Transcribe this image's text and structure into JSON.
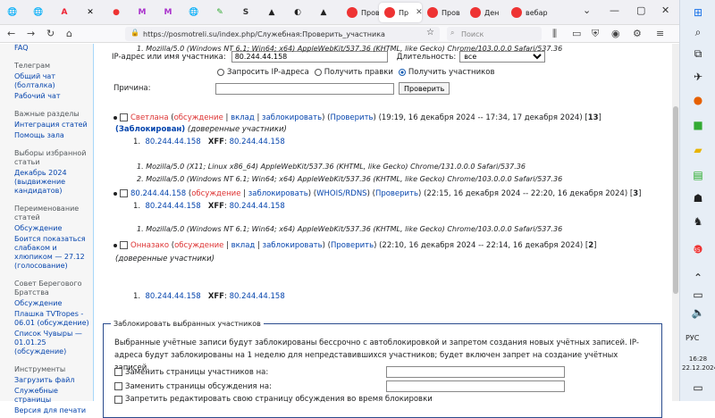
{
  "browser": {
    "pinned": [
      {
        "icon": "globe-icon",
        "char": "🌐",
        "color": "#666"
      },
      {
        "icon": "globe-icon",
        "char": "🌐",
        "color": "#666"
      },
      {
        "icon": "a-letter-icon",
        "char": "A",
        "color": "#e23"
      },
      {
        "icon": "x-icon",
        "char": "✕",
        "color": "#000"
      },
      {
        "icon": "opera-icon",
        "char": "●",
        "color": "#e33"
      },
      {
        "icon": "m-letter-icon",
        "char": "M",
        "color": "#a3c"
      },
      {
        "icon": "m-letter-icon",
        "char": "M",
        "color": "#a3c"
      },
      {
        "icon": "globe-icon",
        "char": "🌐",
        "color": "#666"
      },
      {
        "icon": "lock-icon",
        "char": "✎",
        "color": "#3a3"
      },
      {
        "icon": "s-letter-icon",
        "char": "S",
        "color": "#333"
      },
      {
        "icon": "triangle-icon",
        "char": "▲",
        "color": "#222"
      },
      {
        "icon": "circle-icon",
        "char": "◐",
        "color": "#222"
      },
      {
        "icon": "triangle-icon",
        "char": "▲",
        "color": "#222"
      }
    ],
    "tabs": [
      {
        "label": "Пров",
        "active": false
      },
      {
        "label": "Пр",
        "active": true
      },
      {
        "label": "Пров",
        "active": false
      },
      {
        "label": "Ден",
        "active": false
      },
      {
        "label": "вебар",
        "active": false
      }
    ],
    "url": "https://posmotreli.su/index.php/Служебная:Проверить_участника",
    "search_placeholder": "Поиск"
  },
  "sidebar": {
    "sections": [
      {
        "heading": "",
        "links": [
          "FAQ"
        ]
      },
      {
        "heading": "Телеграм",
        "links": [
          "Общий чат (болталка)",
          "Рабочий чат"
        ]
      },
      {
        "heading": "Важные разделы",
        "links": [
          "Интеграция статей",
          "Помощь зала"
        ]
      },
      {
        "heading": "Выборы избранной статьи",
        "links": [
          "Декабрь 2024 (выдвижение кандидатов)"
        ]
      },
      {
        "heading": "Переименование статей",
        "links": [
          "Обсуждение",
          "Боится показаться слабаком и хлюпиком — 27.12 (голосование)"
        ]
      },
      {
        "heading": "Совет Берегового Братства",
        "links": [
          "Обсуждение",
          "Плашка TVTropes - 06.01 (обсуждение)",
          "Список Чувыры — 01.01.25 (обсуждение)"
        ]
      },
      {
        "heading": "Инструменты",
        "links": [
          "Загрузить файл",
          "Служебные страницы",
          "Версия для печати"
        ]
      }
    ]
  },
  "form": {
    "ip_label": "IP-адрес или имя участника:",
    "ip_value": "80.244.44.158",
    "duration_label": "Длительность:",
    "duration_value": "все",
    "radio1": "Запросить IP-адреса",
    "radio2": "Получить правки",
    "radio3": "Получить участников",
    "reason_label": "Причина:",
    "submit": "Проверить"
  },
  "entries": [
    {
      "name": "Светлана",
      "talk": "обсуждение",
      "contribs": "вклад",
      "block": "заблокировать",
      "check": "Проверить",
      "range": "(19:19, 16 декабря 2024 -- 17:34, 17 декабря 2024)",
      "count": "13",
      "status": "(Заблокирован)",
      "groups": "(доверенные участники)",
      "ip": "80.244.44.158",
      "xff_label": "XFF",
      "xff": "80.244.44.158",
      "ua": [
        "Mozilla/5.0 (X11; Linux x86_64) AppleWebKit/537.36 (KHTML, like Gecko) Chrome/131.0.0.0 Safari/537.36",
        "Mozilla/5.0 (Windows NT 6.1; Win64; x64) AppleWebKit/537.36 (KHTML, like Gecko) Chrome/103.0.0.0 Safari/537.36"
      ]
    },
    {
      "name": "80.244.44.158",
      "talk": "обсуждение",
      "block": "заблокировать",
      "whois": "WHOIS/RDNS",
      "check": "Проверить",
      "range": "(22:15, 16 декабря 2024 -- 22:20, 16 декабря 2024)",
      "count": "3",
      "ip": "80.244.44.158",
      "xff_label": "XFF",
      "xff": "80.244.44.158",
      "ua": [
        "Mozilla/5.0 (Windows NT 6.1; Win64; x64) AppleWebKit/537.36 (KHTML, like Gecko) Chrome/103.0.0.0 Safari/537.36"
      ]
    },
    {
      "name": "Онназако",
      "talk": "обсуждение",
      "contribs": "вклад",
      "block": "заблокировать",
      "check": "Проверить",
      "range": "(22:10, 16 декабря 2024 -- 22:14, 16 декабря 2024)",
      "count": "2",
      "groups": "(доверенные участники)",
      "ip": "80.244.44.158",
      "xff_label": "XFF",
      "xff": "80.244.44.158",
      "ua": [
        "Mozilla/5.0 (Windows NT 6.1; Win64; x64) AppleWebKit/537.36 (KHTML, like Gecko) Chrome/103.0.0.0 Safari/537.36"
      ]
    }
  ],
  "block_section": {
    "legend": "Заблокировать выбранных участников",
    "description": "Выбранные учётные записи будут заблокированы бессрочно с автоблокировкой и запретом создания новых учётных записей. IP-адреса будут заблокированы на 1 неделю для непредставившихся участников; будет включен запрет на создание учётных записей.",
    "opt1": "Заменить страницы участников на:",
    "opt2": "Заменить страницы обсуждения на:",
    "opt3": "Запретить редактировать свою страницу обсуждения во время блокировки"
  },
  "taskbar": {
    "lang": "РУС",
    "time": "16:28",
    "date": "22.12.2024",
    "notif_badge": "35"
  }
}
